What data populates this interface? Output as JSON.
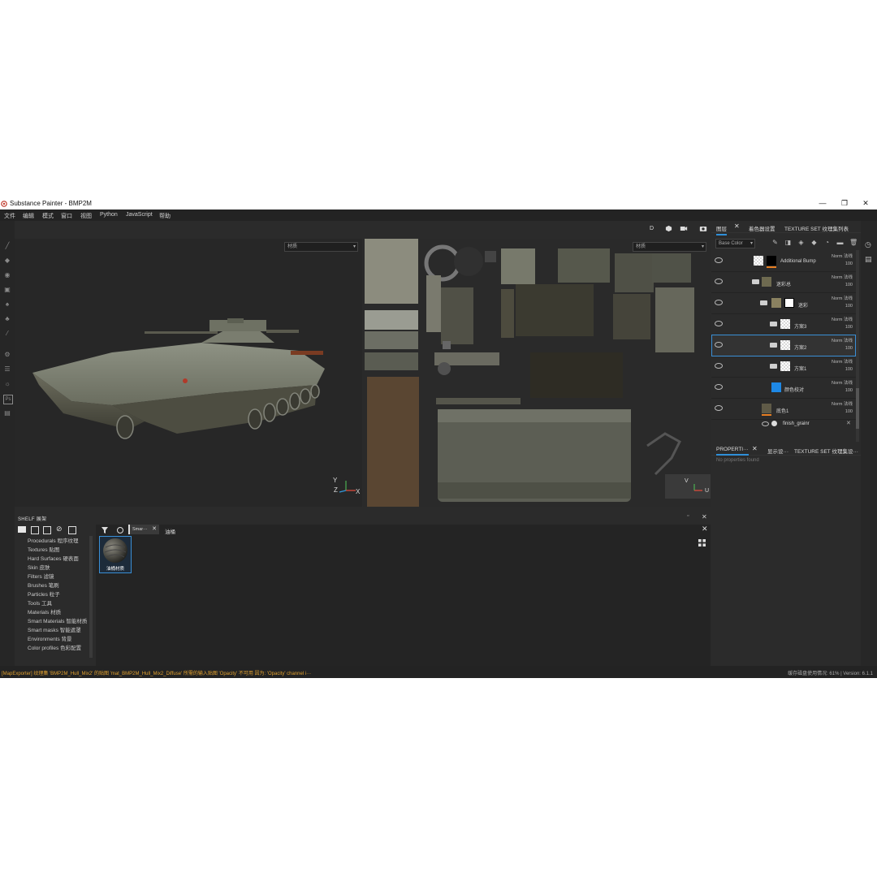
{
  "window": {
    "title": "Substance Painter - BMP2M",
    "controls": [
      "—",
      "❐",
      "✕"
    ]
  },
  "menu": [
    "文件",
    "编辑",
    "模式",
    "窗口",
    "视图",
    "Python",
    "JavaScript",
    "帮助"
  ],
  "viewport": {
    "left_dropdown": "材质",
    "right_dropdown": "材质",
    "axis": {
      "y": "Y",
      "z": "Z",
      "x": "X"
    },
    "uv_axis": {
      "y": "V",
      "x": "U"
    },
    "toolbar_icons": [
      "camera-mode-icon",
      "display-icon",
      "video-icon",
      "screenshot-icon"
    ],
    "camera_mode_label": "D"
  },
  "shelf": {
    "title": "SHELF 展架",
    "categories": [
      "Procedurals 程序纹理",
      "Textures 贴图",
      "Hard Surfaces 硬表面",
      "Skin 皮肤",
      "Filters 滤镜",
      "Brushes 笔刷",
      "Particles 粒子",
      "Tools 工具",
      "Materials 材质",
      "Smart Materials 智能材质",
      "Smart masks 智能遮罩",
      "Environments 背景",
      "Color profiles 色彩配置"
    ],
    "filter_tag": "Smar···",
    "search_value": "油桶",
    "items": [
      {
        "label": "油桶材质"
      }
    ]
  },
  "layers_panel": {
    "tabs": [
      "图层",
      "着色器设置",
      "TEXTURE SET 纹理集列表"
    ],
    "channel": "Base Color",
    "layers": [
      {
        "name": "Additional Bump",
        "blend": "Norm 法线",
        "opacity": "100",
        "kind": "fill-black"
      },
      {
        "name": "迷彩总",
        "blend": "Norm 法线",
        "opacity": "100",
        "kind": "folder-top"
      },
      {
        "name": "迷彩",
        "blend": "Norm 法线",
        "opacity": "100",
        "kind": "folder-mask"
      },
      {
        "name": "方案3",
        "blend": "Norm 法线",
        "opacity": "100",
        "kind": "folder"
      },
      {
        "name": "方案2",
        "blend": "Norm 法线",
        "opacity": "100",
        "kind": "folder-selected"
      },
      {
        "name": "方案1",
        "blend": "Norm 法线",
        "opacity": "100",
        "kind": "folder"
      },
      {
        "name": "颜色校对",
        "blend": "Norm 法线",
        "opacity": "100",
        "kind": "fill-blue"
      },
      {
        "name": "底色1",
        "blend": "Norm 法线",
        "opacity": "100",
        "kind": "paint"
      }
    ],
    "effect": {
      "name": "finish_grainr"
    }
  },
  "properties_panel": {
    "tabs": [
      "PROPERTI···",
      "显示设···",
      "TEXTURE SET 纹理集设···"
    ],
    "empty_text": "No properties found"
  },
  "status": {
    "message": "[MapExporter] 纹理集 'BMP2M_Hull_Mix2' 的贴图 'mat_BMP2M_Hull_Mix2_Diffuse' 所需的输入贴图 'Opacity' 不可用 因为: 'Opacity' channel i···",
    "right": "缓存磁盘使用情况: 61% | Version: 6.1.1"
  },
  "colors": {
    "accent": "#2f8fd8",
    "selected_outline": "#3a8fd6",
    "background": "#2b2b2b"
  }
}
